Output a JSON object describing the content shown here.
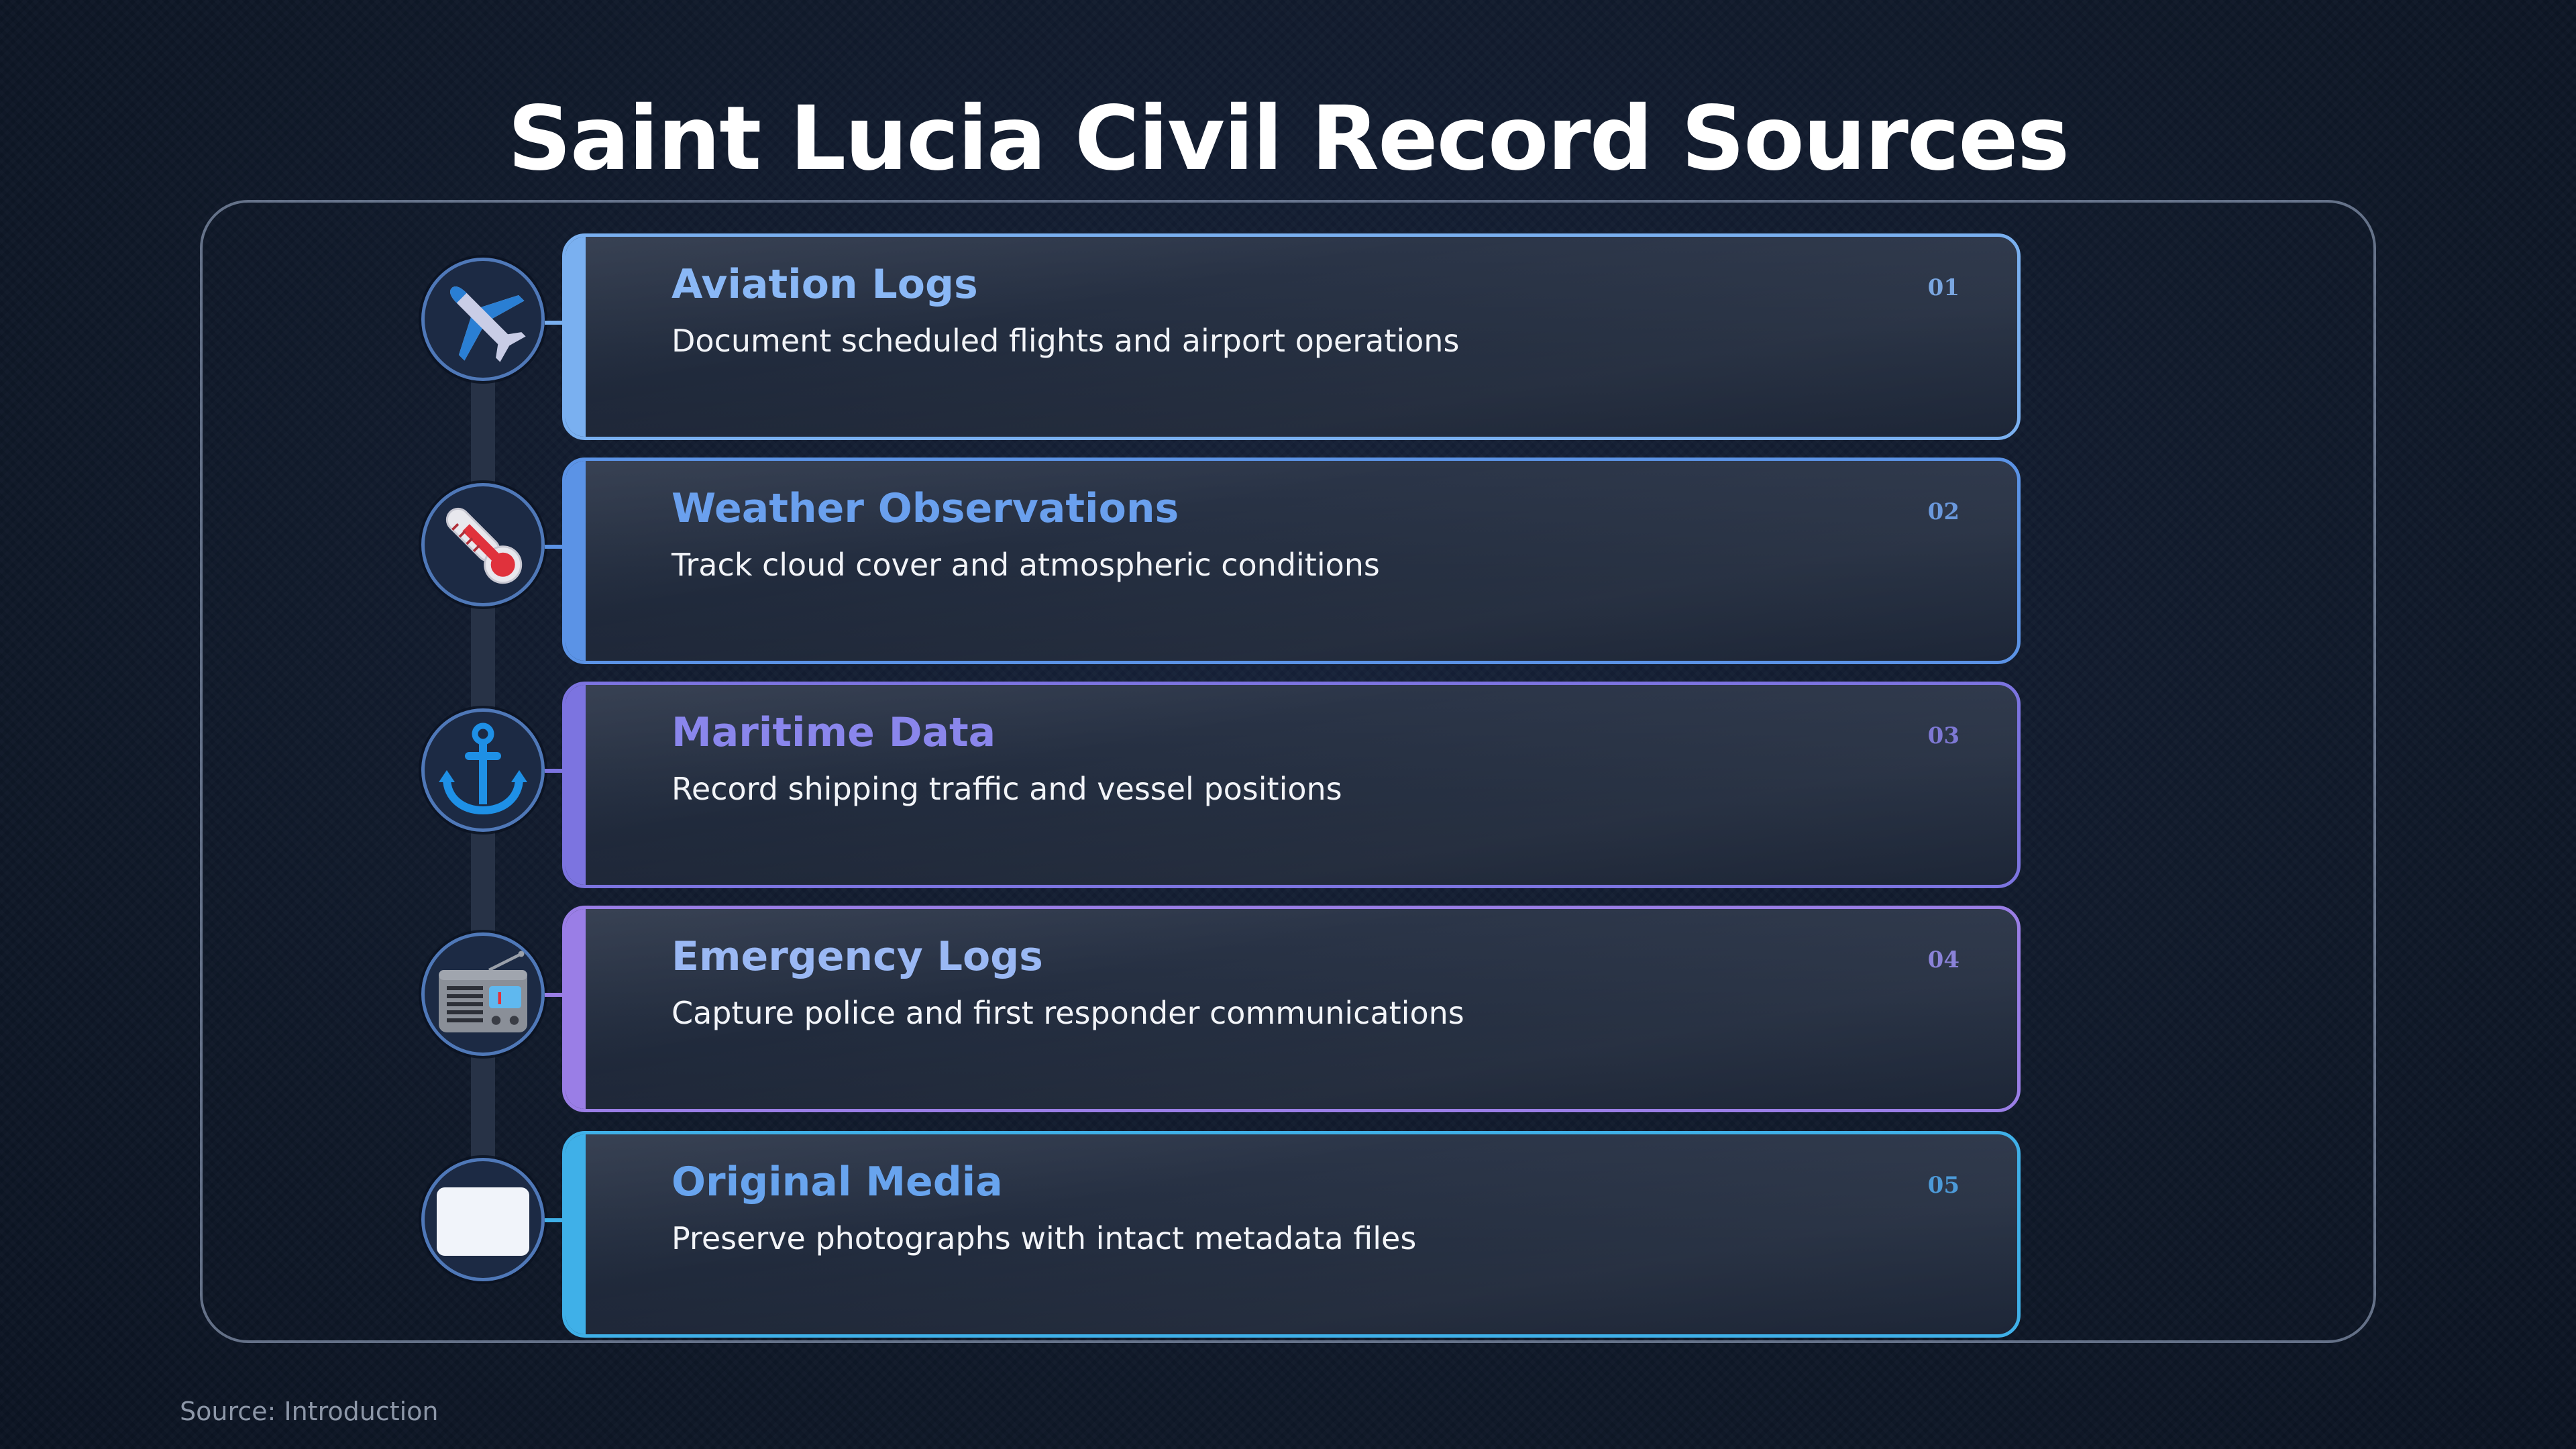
{
  "title": "Saint Lucia Civil Record Sources",
  "source": "Source: Introduction",
  "items": [
    {
      "number": "01",
      "name": "Aviation Logs",
      "description": "Document scheduled flights and airport operations",
      "icon": "airplane-icon",
      "accent": "#7ab0f0",
      "title_color": "#8ab8f6"
    },
    {
      "number": "02",
      "name": "Weather Observations",
      "description": "Track cloud cover and atmospheric conditions",
      "icon": "thermometer-icon",
      "accent": "#5b93e6",
      "title_color": "#6aa0ee"
    },
    {
      "number": "03",
      "name": "Maritime Data",
      "description": "Record shipping traffic and vessel positions",
      "icon": "anchor-icon",
      "accent": "#7c74e0",
      "title_color": "#8a86ec"
    },
    {
      "number": "04",
      "name": "Emergency Logs",
      "description": "Capture police and first responder communications",
      "icon": "radio-icon",
      "accent": "#9a7ee6",
      "title_color": "#9ab8f4"
    },
    {
      "number": "05",
      "name": "Original Media",
      "description": "Preserve photographs with intact metadata files",
      "icon": "photo-frame-icon",
      "accent": "#3fb0e8",
      "title_color": "#68a4ee"
    }
  ]
}
